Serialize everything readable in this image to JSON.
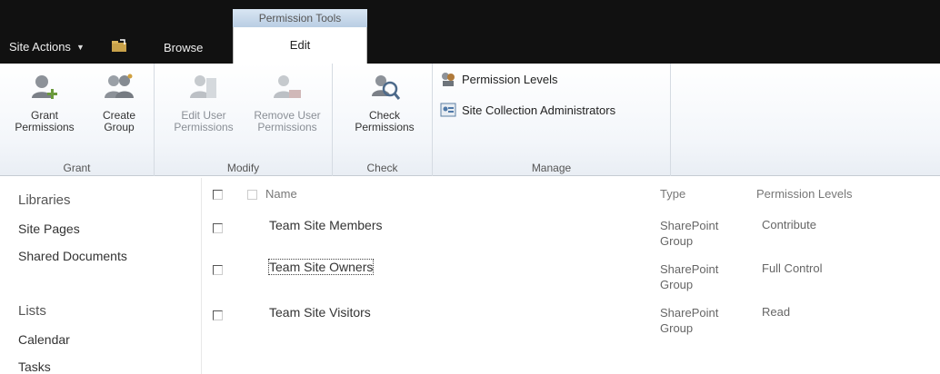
{
  "topbar": {
    "contextual_group": "Permission Tools",
    "site_actions": "Site Actions",
    "tab_browse": "Browse",
    "tab_edit": "Edit"
  },
  "ribbon": {
    "groups": {
      "grant": "Grant",
      "modify": "Modify",
      "check": "Check",
      "manage": "Manage"
    },
    "buttons": {
      "grant_permissions": [
        "Grant",
        "Permissions"
      ],
      "create_group": [
        "Create",
        "Group"
      ],
      "edit_user_permissions": [
        "Edit User",
        "Permissions"
      ],
      "remove_user_permissions": [
        "Remove User",
        "Permissions"
      ],
      "check_permissions": [
        "Check",
        "Permissions"
      ],
      "permission_levels": "Permission Levels",
      "site_collection_admins": "Site Collection Administrators"
    }
  },
  "leftnav": {
    "libraries_heading": "Libraries",
    "libraries": [
      "Site Pages",
      "Shared Documents"
    ],
    "lists_heading": "Lists",
    "lists": [
      "Calendar",
      "Tasks"
    ]
  },
  "list": {
    "headers": {
      "name": "Name",
      "type": "Type",
      "levels": "Permission Levels"
    },
    "rows": [
      {
        "name": "Team Site Members",
        "type": [
          "SharePoint",
          "Group"
        ],
        "level": "Contribute"
      },
      {
        "name": "Team Site Owners",
        "type": [
          "SharePoint",
          "Group"
        ],
        "level": "Full Control"
      },
      {
        "name": "Team Site Visitors",
        "type": [
          "SharePoint",
          "Group"
        ],
        "level": "Read"
      }
    ]
  },
  "icons": {
    "grant": "user-add-icon",
    "create": "group-icon",
    "edit_user": "users-edit-icon",
    "remove_user": "users-remove-icon",
    "check": "magnifier-key-icon",
    "levels": "permission-levels-icon",
    "admins": "admins-icon"
  }
}
